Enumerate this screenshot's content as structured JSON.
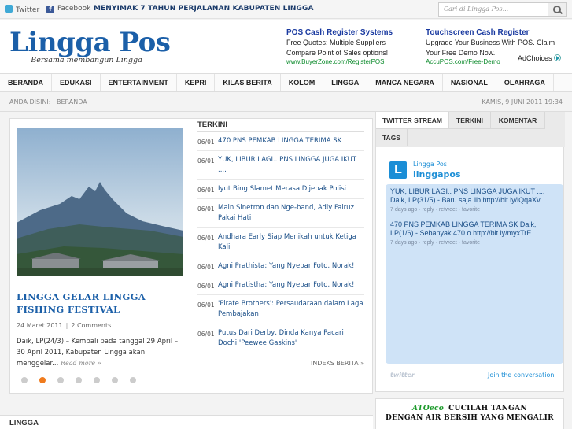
{
  "topbar": {
    "twitter": "Twitter",
    "facebook": "Facebook",
    "ticker": "MENYIMAK 7 TAHUN PERJALANAN KABUPATEN LINGGA",
    "search_placeholder": "Cari di Lingga Pos..."
  },
  "header": {
    "logo": "Lingga Pos",
    "tagline": "Bersama membangun Lingga"
  },
  "ads": [
    {
      "title": "POS Cash Register Systems",
      "text": "Free Quotes: Multiple Suppliers Compare Point of Sales options!",
      "url": "www.BuyerZone.com/RegisterPOS"
    },
    {
      "title": "Touchscreen Cash Register",
      "text": "Upgrade Your Business With POS. Claim Your Free Demo Now.",
      "url": "AccuPOS.com/Free-Demo"
    }
  ],
  "adchoices": "AdChoices",
  "nav": [
    "BERANDA",
    "EDUKASI",
    "ENTERTAINMENT",
    "KEPRI",
    "KILAS BERITA",
    "KOLOM",
    "LINGGA",
    "MANCA NEGARA",
    "NASIONAL",
    "OLAHRAGA"
  ],
  "breadcrumb": {
    "label": "ANDA DISINI:",
    "link": "BERANDA",
    "date": "KAMIS, 9 JUNI 2011 19:34"
  },
  "featured": {
    "title": "LINGGA GELAR LINGGA FISHING FESTIVAL",
    "date": "24 Maret 2011",
    "comments": "2 Comments",
    "excerpt": "Daik, LP(24/3) – Kembali pada tanggal 29 April – 30 April 2011, Kabupaten Lingga akan menggelar...",
    "more": "Read more »",
    "slides": 7,
    "active_slide": 2
  },
  "latest": {
    "heading": "TERKINI",
    "items": [
      {
        "date": "06/01",
        "title": "470 PNS PEMKAB LINGGA TERIMA SK"
      },
      {
        "date": "06/01",
        "title": "YUK, LIBUR LAGI.. PNS LINGGA JUGA IKUT ...."
      },
      {
        "date": "06/01",
        "title": "Iyut Bing Slamet Merasa Dijebak Polisi"
      },
      {
        "date": "06/01",
        "title": "Main Sinetron dan Nge-band, Adly Fairuz Pakai Hati"
      },
      {
        "date": "06/01",
        "title": "Andhara Early Siap Menikah untuk Ketiga Kali"
      },
      {
        "date": "06/01",
        "title": "Agni Prathista: Yang Nyebar Foto, Norak!"
      },
      {
        "date": "06/01",
        "title": "Agni Pratistha: Yang Nyebar Foto, Norak!"
      },
      {
        "date": "06/01",
        "title": "'Pirate Brothers': Persaudaraan dalam Laga Pembajakan"
      },
      {
        "date": "06/01",
        "title": "Putus Dari Derby, Dinda Kanya Pacari Dochi 'Peewee Gaskins'"
      }
    ],
    "more": "INDEKS BERITA »"
  },
  "sidebar": {
    "tabs": [
      "TWITTER STREAM",
      "TERKINI",
      "KOMENTAR",
      "TAGS"
    ],
    "twitter_name": "Lingga Pos",
    "twitter_handle": "linggapos",
    "tweets": [
      {
        "text": "YUK, LIBUR LAGI.. PNS LINGGA JUGA IKUT .... Daik, LP(31/5) - Baru saja lib http://bit.ly/iQqaXv",
        "meta": "7 days ago · reply · retweet · favorite"
      },
      {
        "text": "470 PNS PEMKAB LINGGA TERIMA SK Daik, LP(1/6) - Sebanyak 470 o http://bit.ly/myxTrE",
        "meta": "7 days ago · reply · retweet · favorite"
      }
    ],
    "join": "Join the conversation",
    "widget_brand": "twitter"
  },
  "section_title": "LINGGA",
  "water_ad": {
    "brand": "ATOeco",
    "line1": "CUCILAH TANGAN",
    "line2": "DENGAN AIR BERSIH YANG MENGALIR"
  },
  "colors": {
    "brand_blue": "#1b5fa8",
    "twitter_blue": "#1b8ed6",
    "active_dot": "#f07b1d"
  }
}
